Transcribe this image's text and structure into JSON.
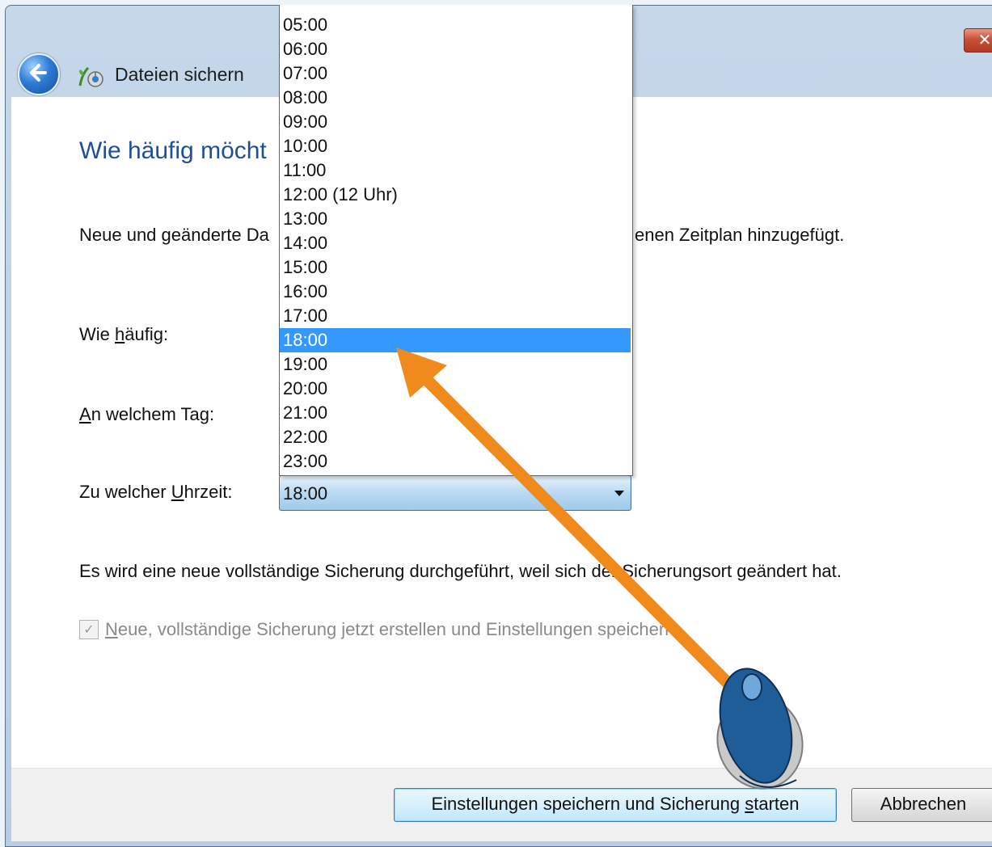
{
  "window": {
    "title": "Dateien sichern",
    "close_glyph": "✕"
  },
  "dialog": {
    "heading": "Wie häufig möcht",
    "intro_left": "Neue und geänderte Da",
    "intro_right": "enen Zeitplan hinzugefügt.",
    "labels": {
      "frequency_pre": "Wie ",
      "frequency_key": "h",
      "frequency_post": "äufig:",
      "day_key": "A",
      "day_post": "n welchem Tag:",
      "time_pre": "Zu welcher ",
      "time_key": "U",
      "time_post": "hrzeit:"
    },
    "time_value": "18:00",
    "notice": "Es wird eine neue vollständige Sicherung durchgeführt, weil sich der Sicherungsort geändert hat.",
    "checkbox": {
      "checked": true,
      "label_key": "N",
      "label_rest": "eue, vollständige Sicherung jetzt erstellen und Einstellungen speichern"
    }
  },
  "buttons": {
    "save_pre": "Einstellungen speichern und Sicherung ",
    "save_key": "s",
    "save_post": "tarten",
    "cancel": "Abbrechen"
  },
  "time_dropdown": {
    "selected": "18:00",
    "options": [
      "05:00",
      "06:00",
      "07:00",
      "08:00",
      "09:00",
      "10:00",
      "11:00",
      "12:00 (12 Uhr)",
      "13:00",
      "14:00",
      "15:00",
      "16:00",
      "17:00",
      "18:00",
      "19:00",
      "20:00",
      "21:00",
      "22:00",
      "23:00"
    ]
  },
  "annotation": {
    "arrow_color": "#f08a1d",
    "pointer": "mouse-icon"
  }
}
